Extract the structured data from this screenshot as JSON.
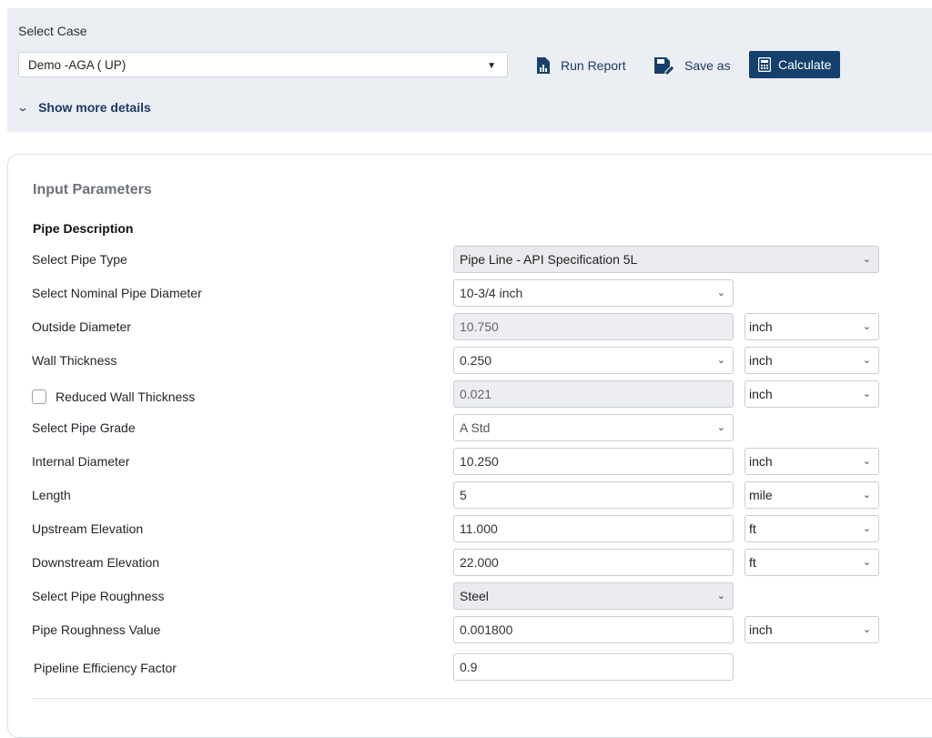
{
  "header": {
    "select_case_label": "Select Case",
    "case_value": "Demo -AGA ( UP)",
    "run_report_label": "Run Report",
    "save_as_label": "Save as",
    "calculate_label": "Calculate",
    "show_more_label": "Show more details"
  },
  "icons": {
    "run_report": "report-icon",
    "save_as": "save-edit-icon",
    "calculate": "calculator-icon",
    "dropdown": "caret-down-icon",
    "expand": "chevron-down-icon"
  },
  "colors": {
    "accent": "#14406b",
    "link": "#1b3a66",
    "panel": "#ebeef3"
  },
  "section": {
    "title": "Input Parameters",
    "subtitle": "Pipe Description"
  },
  "rows": [
    {
      "label": "Select Pipe Type",
      "value": "Pipe Line - API Specification 5L"
    },
    {
      "label": "Select Nominal Pipe Diameter",
      "value": "10-3/4 inch"
    },
    {
      "label": "Outside Diameter",
      "value": "10.750",
      "unit": "inch"
    },
    {
      "label": "Wall Thickness",
      "value": "0.250",
      "unit": "inch"
    },
    {
      "label": "Reduced Wall Thickness",
      "value": "0.021",
      "unit": "inch",
      "checked": false
    },
    {
      "label": "Select Pipe Grade",
      "value": "A Std"
    },
    {
      "label": "Internal Diameter",
      "value": "10.250",
      "unit": "inch"
    },
    {
      "label": "Length",
      "value": "5",
      "unit": "mile"
    },
    {
      "label": "Upstream Elevation",
      "value": "11.000",
      "unit": "ft"
    },
    {
      "label": "Downstream Elevation",
      "value": "22.000",
      "unit": "ft"
    },
    {
      "label": "Select Pipe Roughness",
      "value": "Steel"
    },
    {
      "label": "Pipe Roughness Value",
      "value": "0.001800",
      "unit": "inch"
    },
    {
      "label": "Pipeline Efficiency Factor",
      "value": "0.9"
    }
  ]
}
